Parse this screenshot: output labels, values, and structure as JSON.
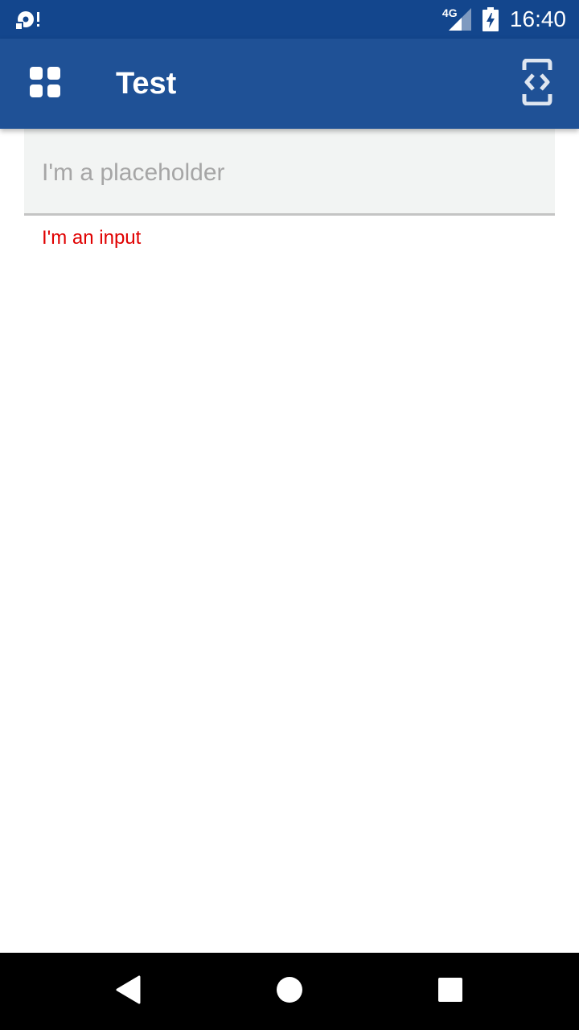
{
  "status_bar": {
    "network_label": "4G",
    "time": "16:40",
    "left_icon": "sync-alert-icon",
    "signal_icon": "signal-icon",
    "battery_icon": "battery-charging-icon"
  },
  "app_bar": {
    "title": "Test",
    "menu_icon": "grid-icon",
    "action_icon": "code-brackets-icon",
    "background": "#1f5196"
  },
  "form": {
    "input": {
      "value": "",
      "placeholder": "I'm a placeholder"
    },
    "helper_text": "I'm an input",
    "helper_color": "#e00000"
  },
  "nav_bar": {
    "back_icon": "back-triangle-icon",
    "home_icon": "home-circle-icon",
    "recents_icon": "recents-square-icon"
  }
}
